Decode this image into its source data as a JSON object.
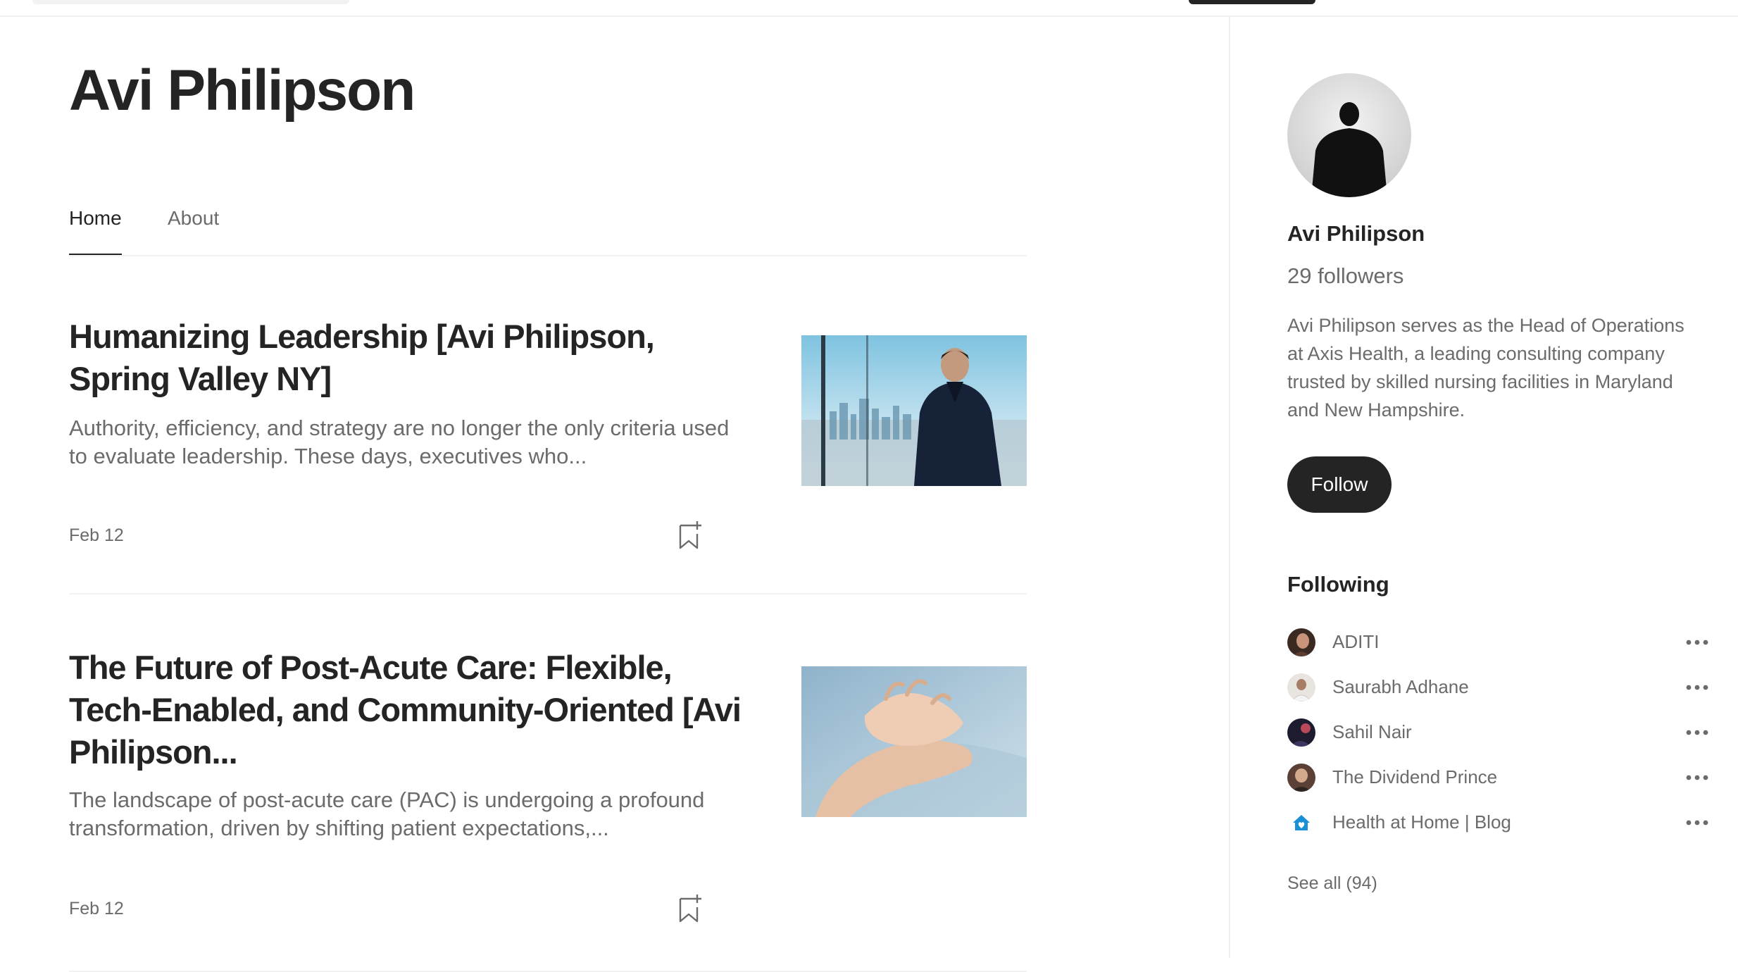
{
  "profile": {
    "name": "Avi Philipson",
    "followers": "29 followers",
    "bio": "Avi Philipson serves as the Head of Operations at Axis Health, a leading consulting company trusted by skilled nursing facilities in Maryland and New Hampshire.",
    "follow_label": "Follow"
  },
  "tabs": [
    {
      "label": "Home",
      "active": true
    },
    {
      "label": "About",
      "active": false
    }
  ],
  "articles": [
    {
      "title": "Humanizing Leadership [Avi Philipson, Spring Valley NY]",
      "excerpt": "Authority, efficiency, and strategy are no longer the only criteria used to evaluate leadership. These days, executives who...",
      "date": "Feb 12",
      "thumbnail": "businessman-cityscape-image"
    },
    {
      "title": "The Future of Post-Acute Care: Flexible, Tech-Enabled, and Community-Oriented [Avi Philipson...",
      "excerpt": "The landscape of post-acute care (PAC) is undergoing a profound transformation, driven by shifting patient expectations,...",
      "date": "Feb 12",
      "thumbnail": "holding-hands-image"
    }
  ],
  "following": {
    "heading": "Following",
    "items": [
      {
        "name": "ADITI",
        "avatar": "aditi-avatar"
      },
      {
        "name": "Saurabh Adhane",
        "avatar": "saurabh-adhane-avatar"
      },
      {
        "name": "Sahil Nair",
        "avatar": "sahil-nair-avatar"
      },
      {
        "name": "The Dividend Prince",
        "avatar": "the-dividend-prince-avatar"
      },
      {
        "name": "Health at Home | Blog",
        "avatar": "home-heart-icon"
      }
    ],
    "see_all": "See all (94)"
  },
  "icons": {
    "bookmark": "bookmark-add-icon",
    "more": "more-dots-icon"
  },
  "colors": {
    "text_primary": "#242424",
    "text_secondary": "#6b6b6b",
    "button_bg": "#242424",
    "divider": "#f2f2f2",
    "brand_blue": "#1a8fd6"
  }
}
